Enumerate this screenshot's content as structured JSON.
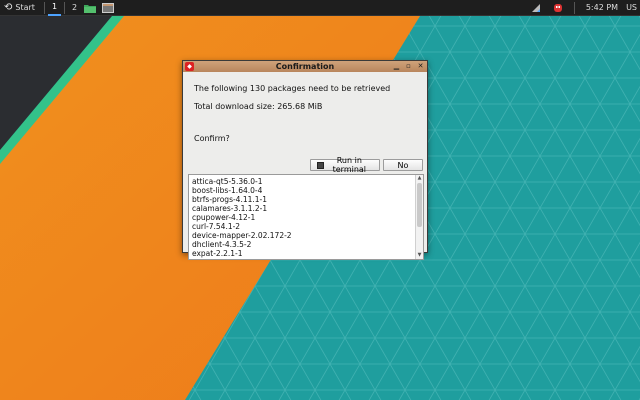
{
  "taskbar": {
    "start_label": "Start",
    "workspaces": [
      "1",
      "2"
    ],
    "active_workspace": "1",
    "icons": [
      "file-manager-icon",
      "network-icon",
      "app-indicator-icon"
    ],
    "clock": "5:42 PM",
    "locale": "US"
  },
  "window": {
    "title": "Confirmation",
    "controls": [
      "minimize",
      "maximize",
      "close"
    ],
    "message_line1": "The following 130 packages need to be retrieved",
    "message_line2": "Total download size: 265.68 MiB",
    "confirm_label": "Confirm?",
    "run_in_terminal_label": "Run in terminal",
    "no_label": "No",
    "packages": [
      "attica-qt5-5.36.0-1",
      "boost-libs-1.64.0-4",
      "btrfs-progs-4.11.1-1",
      "calamares-3.1.1.2-1",
      "cpupower-4.12-1",
      "curl-7.54.1-2",
      "device-mapper-2.02.172-2",
      "dhclient-4.3.5-2",
      "expat-2.2.1-1"
    ]
  },
  "colors": {
    "wallpaper_teal": "#1f9e9e",
    "wallpaper_orange": "#f08a1c",
    "wallpaper_dark": "#2a2c30",
    "wallpaper_green_stripe": "#33c28a",
    "titlebar": "#c49670"
  }
}
